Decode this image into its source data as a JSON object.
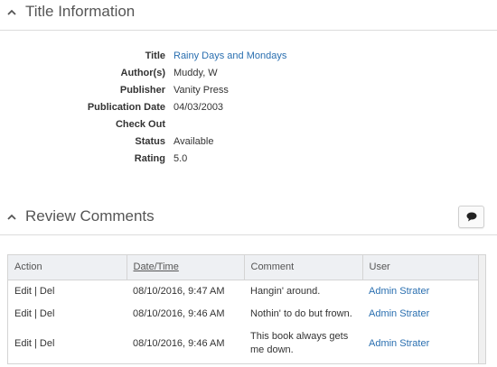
{
  "title_section": {
    "heading": "Title Information",
    "fields": [
      {
        "label": "Title",
        "value": "Rainy Days and Mondays",
        "is_link": true
      },
      {
        "label": "Author(s)",
        "value": "Muddy, W",
        "is_link": false
      },
      {
        "label": "Publisher",
        "value": "Vanity Press",
        "is_link": false
      },
      {
        "label": "Publication Date",
        "value": "04/03/2003",
        "is_link": false
      },
      {
        "label": "Check Out",
        "value": "",
        "is_link": false
      },
      {
        "label": "Status",
        "value": "Available",
        "is_link": false
      },
      {
        "label": "Rating",
        "value": "5.0",
        "is_link": false
      }
    ]
  },
  "review_section": {
    "heading": "Review Comments",
    "add_comment_icon": "comment-icon",
    "columns": [
      "Action",
      "Date/Time",
      "Comment",
      "User"
    ],
    "rows": [
      {
        "action": "Edit | Del",
        "datetime": "08/10/2016, 9:47 AM",
        "comment": "Hangin' around.",
        "user": "Admin Strater"
      },
      {
        "action": "Edit | Del",
        "datetime": "08/10/2016, 9:46 AM",
        "comment": "Nothin' to do but frown.",
        "user": "Admin Strater"
      },
      {
        "action": "Edit | Del",
        "datetime": "08/10/2016, 9:46 AM",
        "comment": "This book always gets me down.",
        "user": "Admin Strater"
      }
    ]
  },
  "colors": {
    "link": "#2a6fb0",
    "header_bg": "#eef0f3",
    "border": "#d4d4d4"
  }
}
